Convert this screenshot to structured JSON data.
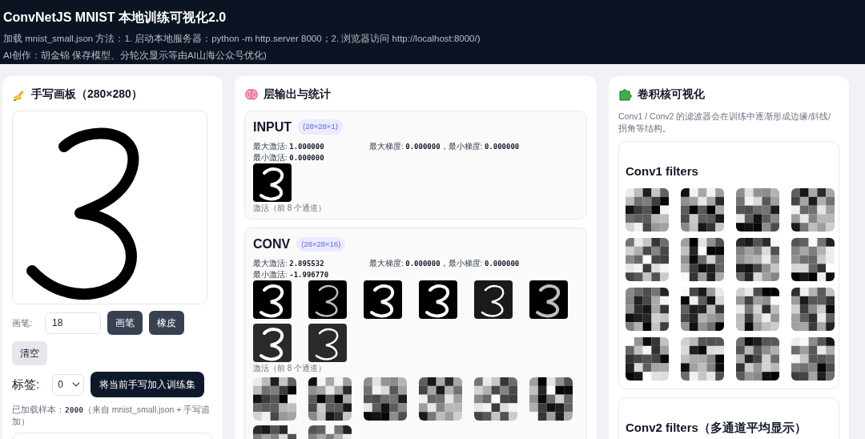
{
  "header": {
    "title": "ConvNetJS MNIST 本地训练可视化2.0",
    "instructions": "加载 mnist_small.json 方法：1. 启动本地服务器：python -m http.server 8000；2. 浏览器访问 http://localhost:8000/)",
    "credits": "AI创作：胡金锦 保存模型、分轮次显示等由AI山海公众号优化)"
  },
  "draw_panel": {
    "title": "手写画板（280×280）",
    "brush_label": "画笔:",
    "brush_size": "18",
    "buttons": [
      {
        "label": "画笔",
        "kind": "dark"
      },
      {
        "label": "橡皮",
        "kind": "dark"
      },
      {
        "label": "清空",
        "kind": "light"
      }
    ],
    "label_label": "标签:",
    "label_value": "0",
    "add_button": "将当前手写加入训练集",
    "samples_prefix": "已加载样本：",
    "samples_count": "2000",
    "samples_suffix": "（来自 mnist_small.json + 手写追加）"
  },
  "layers_panel": {
    "title": "层输出与统计",
    "layers": [
      {
        "name": "INPUT",
        "kind": "input",
        "shape": "(28×28×1)",
        "activation_stats": [
          {
            "label": "最大激活:",
            "value": "1.000000"
          },
          {
            "label": "最小激活:",
            "value": "0.000000"
          }
        ],
        "gradient_stats": [
          {
            "label": "最大梯度:",
            "value": "0.000000"
          },
          {
            "label": "，最小梯度:",
            "value": "0.000000"
          }
        ],
        "caption": "激活（前 8 个通道）"
      },
      {
        "name": "CONV",
        "kind": "conv",
        "shape": "(28×28×16)",
        "activation_stats": [
          {
            "label": "最大激活:",
            "value": "2.895532"
          },
          {
            "label": "最小激活:",
            "value": "-1.996770"
          }
        ],
        "gradient_stats": [
          {
            "label": "最大梯度:",
            "value": "0.000000"
          },
          {
            "label": "，最小梯度:",
            "value": "0.000000"
          }
        ],
        "caption": "激活（前 8 个通道）"
      }
    ]
  },
  "filters_panel": {
    "title": "卷积核可视化",
    "description": "Conv1 / Conv2 的滤波器会在训练中逐渐形成边缘/斜线/拐角等结构。",
    "groups": [
      {
        "title": "Conv1 filters"
      },
      {
        "title": "Conv2 filters（多通道平均显示）"
      }
    ]
  }
}
